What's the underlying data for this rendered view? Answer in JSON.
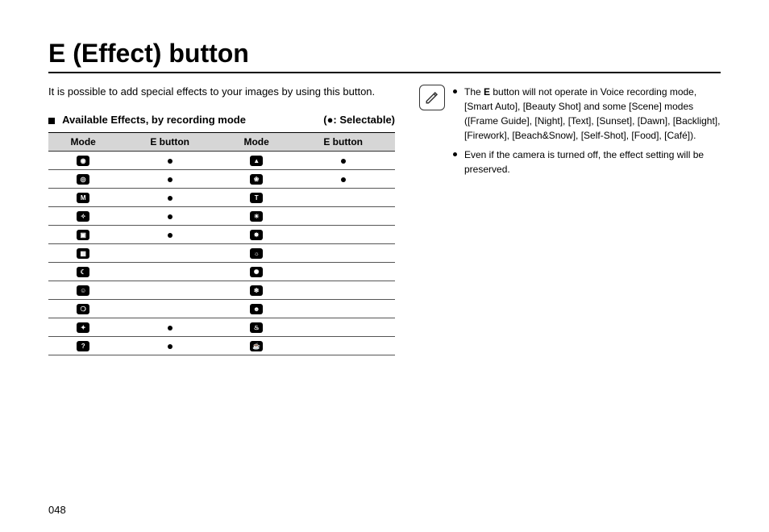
{
  "title": "E (Effect) button",
  "intro": "It is possible to add special effects to your images by using this button.",
  "subheading": "Available Effects, by recording mode",
  "legend": "(●: Selectable)",
  "table": {
    "headers": [
      "Mode",
      "E button",
      "Mode",
      "E button"
    ],
    "rows": [
      {
        "m1": "camera-icon",
        "g1": "camera-icon",
        "s1": true,
        "m2": "landscape-icon",
        "g2": "landscape-icon",
        "s2": true
      },
      {
        "m1": "camera-alt-icon",
        "g1": "camera-alt-icon",
        "s1": true,
        "m2": "close-up-icon",
        "g2": "close-up-icon",
        "s2": true
      },
      {
        "m1": "manual-icon",
        "g1": "manual-icon",
        "s1": true,
        "m2": "text-icon",
        "g2": "text-icon",
        "s2": false
      },
      {
        "m1": "dis-icon",
        "g1": "dis-icon",
        "s1": true,
        "m2": "sunset-icon",
        "g2": "sunset-icon",
        "s2": false
      },
      {
        "m1": "movie-icon",
        "g1": "movie-icon",
        "s1": true,
        "m2": "dawn-icon",
        "g2": "dawn-icon",
        "s2": false
      },
      {
        "m1": "frame-guide-icon",
        "g1": "frame-guide-icon",
        "s1": false,
        "m2": "backlight-icon",
        "g2": "backlight-icon",
        "s2": false
      },
      {
        "m1": "night-icon",
        "g1": "night-icon",
        "s1": false,
        "m2": "firework-icon",
        "g2": "firework-icon",
        "s2": false
      },
      {
        "m1": "portrait-icon",
        "g1": "portrait-icon",
        "s1": false,
        "m2": "beach-snow-icon",
        "g2": "beach-snow-icon",
        "s2": false
      },
      {
        "m1": "children-icon",
        "g1": "children-icon",
        "s1": false,
        "m2": "self-shot-icon",
        "g2": "self-shot-icon",
        "s2": false
      },
      {
        "m1": "smart-auto-icon",
        "g1": "smart-auto-icon",
        "s1": true,
        "m2": "food-icon",
        "g2": "food-icon",
        "s2": false
      },
      {
        "m1": "photo-help-icon",
        "g1": "photo-help-icon",
        "s1": true,
        "m2": "cafe-icon",
        "g2": "cafe-icon",
        "s2": false
      }
    ]
  },
  "notes": [
    "The E button will not operate in Voice recording mode, [Smart Auto], [Beauty Shot] and some [Scene] modes ([Frame Guide], [Night], [Text], [Sunset], [Dawn], [Backlight], [Firework], [Beach&Snow], [Self-Shot], [Food], [Café]).",
    "Even if the camera is turned off, the effect setting will be preserved."
  ],
  "note_bold_letter": "E",
  "page_number": "048"
}
